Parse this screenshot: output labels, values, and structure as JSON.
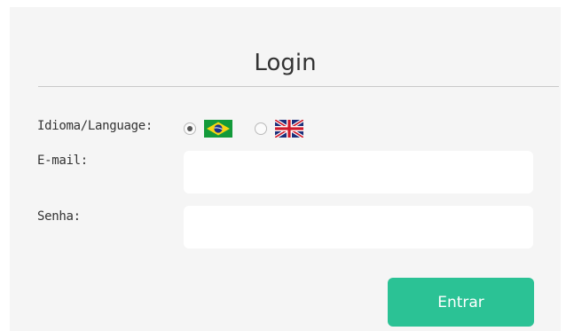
{
  "login": {
    "title": "Login",
    "language_label": "Idioma/Language:",
    "languages": [
      {
        "name": "Português (Brasil)",
        "icon": "brazil-flag-icon",
        "selected": true
      },
      {
        "name": "English",
        "icon": "uk-flag-icon",
        "selected": false
      }
    ],
    "email_label": "E-mail:",
    "email_value": "",
    "password_label": "Senha:",
    "password_value": "",
    "submit_label": "Entrar"
  },
  "colors": {
    "accent": "#2bc295",
    "panel_bg": "#f5f5f5",
    "input_bg": "#ffffff",
    "text": "#333333"
  }
}
